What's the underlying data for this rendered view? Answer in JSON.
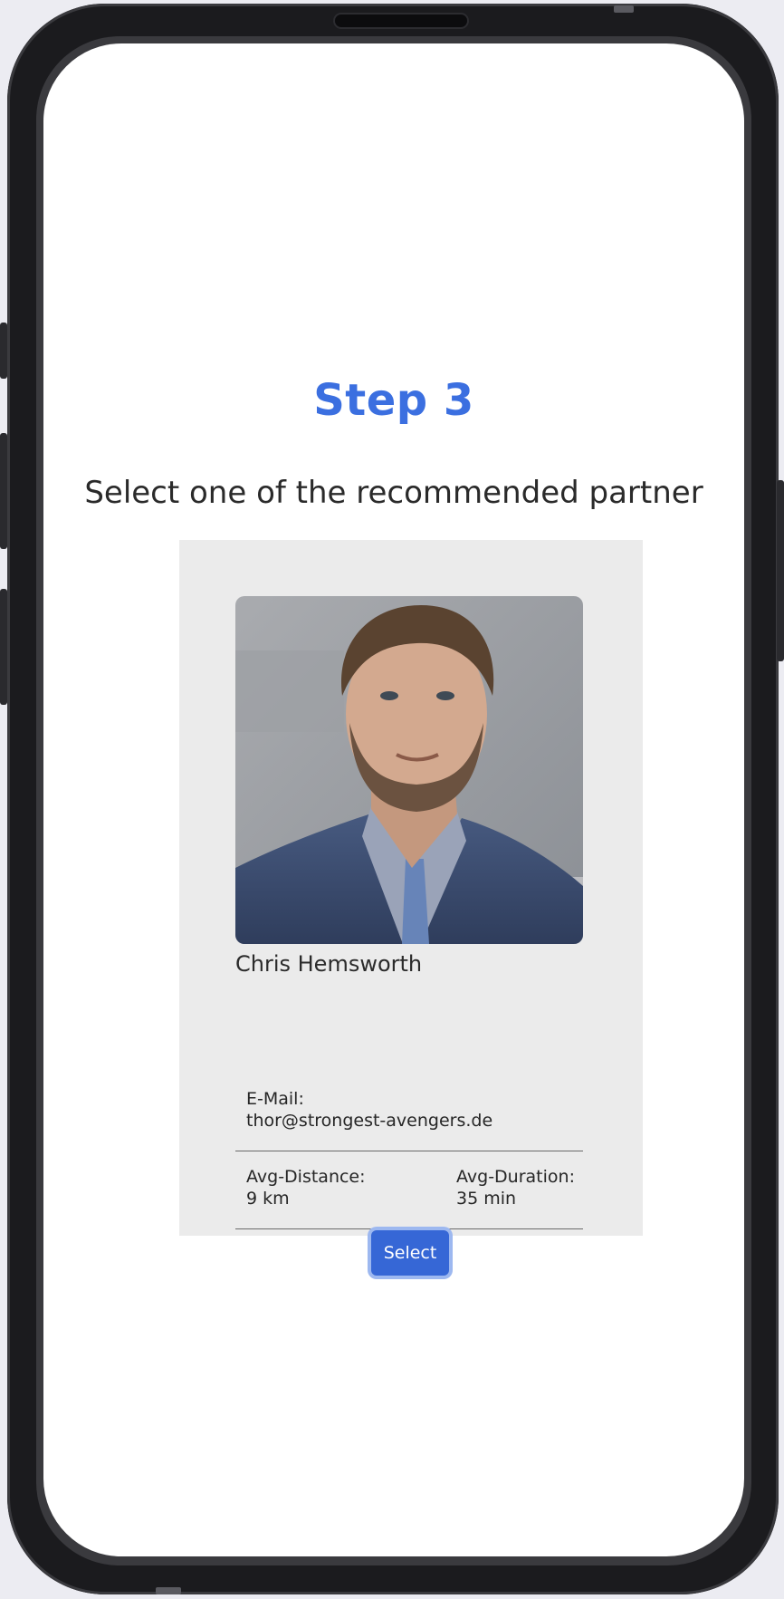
{
  "header": {
    "step_title": "Step 3",
    "subtitle": "Select one of the recommended partner"
  },
  "partner": {
    "name": "Chris Hemsworth",
    "email_label": "E-Mail:",
    "email": "thor@strongest-avengers.de",
    "distance_label": "Avg-Distance:",
    "distance": "9 km",
    "duration_label": "Avg-Duration:",
    "duration": "35 min",
    "select_label": "Select"
  },
  "colors": {
    "accent": "#3b6fe0",
    "button": "#3667d6",
    "card_background": "#ebebeb"
  }
}
